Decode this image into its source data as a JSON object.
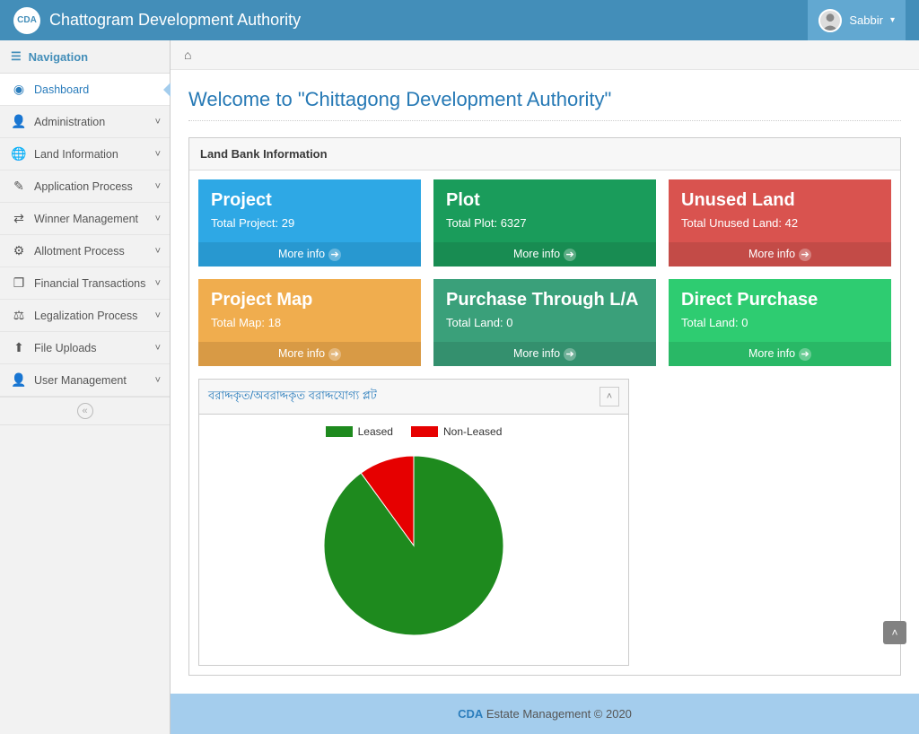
{
  "topbar": {
    "brand": "Chattogram Development Authority",
    "user_name": "Sabbir"
  },
  "sidebar": {
    "header": "Navigation",
    "items": [
      {
        "label": "Dashboard",
        "icon": "◉",
        "active": true,
        "expandable": false
      },
      {
        "label": "Administration",
        "icon": "👤",
        "active": false,
        "expandable": true
      },
      {
        "label": "Land Information",
        "icon": "🌐",
        "active": false,
        "expandable": true
      },
      {
        "label": "Application Process",
        "icon": "✎",
        "active": false,
        "expandable": true
      },
      {
        "label": "Winner Management",
        "icon": "⇄",
        "active": false,
        "expandable": true
      },
      {
        "label": "Allotment Process",
        "icon": "⚙",
        "active": false,
        "expandable": true
      },
      {
        "label": "Financial Transactions",
        "icon": "❐",
        "active": false,
        "expandable": true
      },
      {
        "label": "Legalization Process",
        "icon": "⚖",
        "active": false,
        "expandable": true
      },
      {
        "label": "File Uploads",
        "icon": "⬆",
        "active": false,
        "expandable": true
      },
      {
        "label": "User Management",
        "icon": "👤",
        "active": false,
        "expandable": true
      }
    ]
  },
  "page": {
    "title": "Welcome to \"Chittagong Development Authority\"",
    "panel_title": "Land Bank Information"
  },
  "cards": [
    {
      "title": "Project",
      "sub": "Total Project: 29",
      "more": "More info",
      "cls": "c-blue"
    },
    {
      "title": "Plot",
      "sub": "Total Plot: 6327",
      "more": "More info",
      "cls": "c-green"
    },
    {
      "title": "Unused Land",
      "sub": "Total Unused Land: 42",
      "more": "More info",
      "cls": "c-red"
    },
    {
      "title": "Project Map",
      "sub": "Total Map: 18",
      "more": "More info",
      "cls": "c-orange"
    },
    {
      "title": "Purchase Through L/A",
      "sub": "Total Land: 0",
      "more": "More info",
      "cls": "c-teal"
    },
    {
      "title": "Direct Purchase",
      "sub": "Total Land: 0",
      "more": "More info",
      "cls": "c-mint"
    }
  ],
  "chart": {
    "title": "বরাদ্দকৃত/অবরাদ্দকৃত বরাদ্দযোগ্য প্লট",
    "legend": {
      "leased": "Leased",
      "nonleased": "Non-Leased"
    }
  },
  "chart_data": {
    "type": "pie",
    "series": [
      {
        "name": "Leased",
        "value": 90,
        "color": "#1e8a1e"
      },
      {
        "name": "Non-Leased",
        "value": 10,
        "color": "#e60000"
      }
    ],
    "title": "বরাদ্দকৃত/অবরাদ্দকৃত বরাদ্দযোগ্য প্লট"
  },
  "footer": {
    "cda": "CDA",
    "rest": " Estate Management © 2020"
  }
}
